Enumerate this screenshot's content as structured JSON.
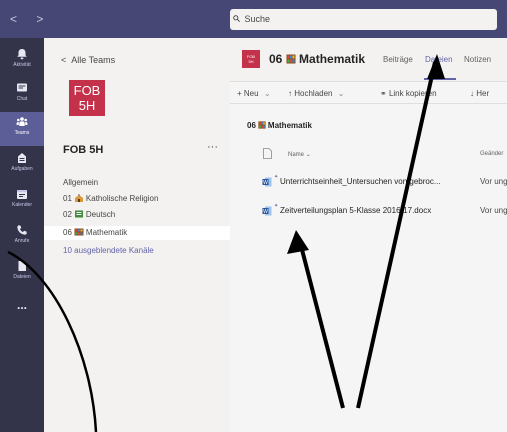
{
  "search": {
    "placeholder": "Suche",
    "icon": "search-icon"
  },
  "nav": {
    "back_forward": "< >"
  },
  "rail": {
    "items": [
      {
        "label": "Aktivität",
        "icon": "bell-icon"
      },
      {
        "label": "Chat",
        "icon": "chat-icon"
      },
      {
        "label": "Teams",
        "icon": "teams-icon",
        "active": true
      },
      {
        "label": "Aufgaben",
        "icon": "assignments-icon"
      },
      {
        "label": "Kalender",
        "icon": "calendar-icon"
      },
      {
        "label": "Anrufe",
        "icon": "phone-icon"
      },
      {
        "label": "Dateien",
        "icon": "files-icon"
      },
      {
        "label": "...",
        "icon": "more-icon"
      }
    ]
  },
  "teams_panel": {
    "back_label": "Alle Teams",
    "tile_text": "FOB 5H",
    "tile_line1": "FOB",
    "tile_line2": "5H",
    "team_name": "FOB 5H",
    "more": "···",
    "channels": [
      {
        "label": "Allgemein"
      },
      {
        "label": "01 Katholische Religion",
        "prefix": "01",
        "name": "Katholische Religion"
      },
      {
        "label": "02 Deutsch",
        "prefix": "02",
        "name": "Deutsch"
      },
      {
        "label": "06 Mathematik",
        "prefix": "06",
        "name": "Mathematik",
        "active": true
      },
      {
        "label": "10 ausgeblendete Kanäle"
      }
    ]
  },
  "channel": {
    "tile_line1": "FOB",
    "tile_line2": "5H",
    "title_prefix": "06",
    "title_name": "Mathematik",
    "tabs": [
      {
        "label": "Beiträge"
      },
      {
        "label": "Dateien",
        "active": true
      },
      {
        "label": "Notizen"
      }
    ]
  },
  "commands": {
    "new_label": "+ Neu",
    "upload_label": "Hochladen",
    "link_label": "Link kopieren",
    "download_label": "Her"
  },
  "breadcrumb": {
    "prefix": "06",
    "name": "Mathematik"
  },
  "columns": {
    "name": "Name",
    "modified": "Geänder"
  },
  "files": [
    {
      "name": "Unterrichtseinheit_Untersuchen von gebroc...",
      "modified": "Vor ung"
    },
    {
      "name": "Zeitverteilungsplan 5-Klasse 2016-17.docx",
      "modified": "Vor ung"
    }
  ],
  "colors": {
    "topbar": "#464775",
    "rail": "#33344a",
    "accent": "#6264a7",
    "team_tile": "#c4314b"
  }
}
